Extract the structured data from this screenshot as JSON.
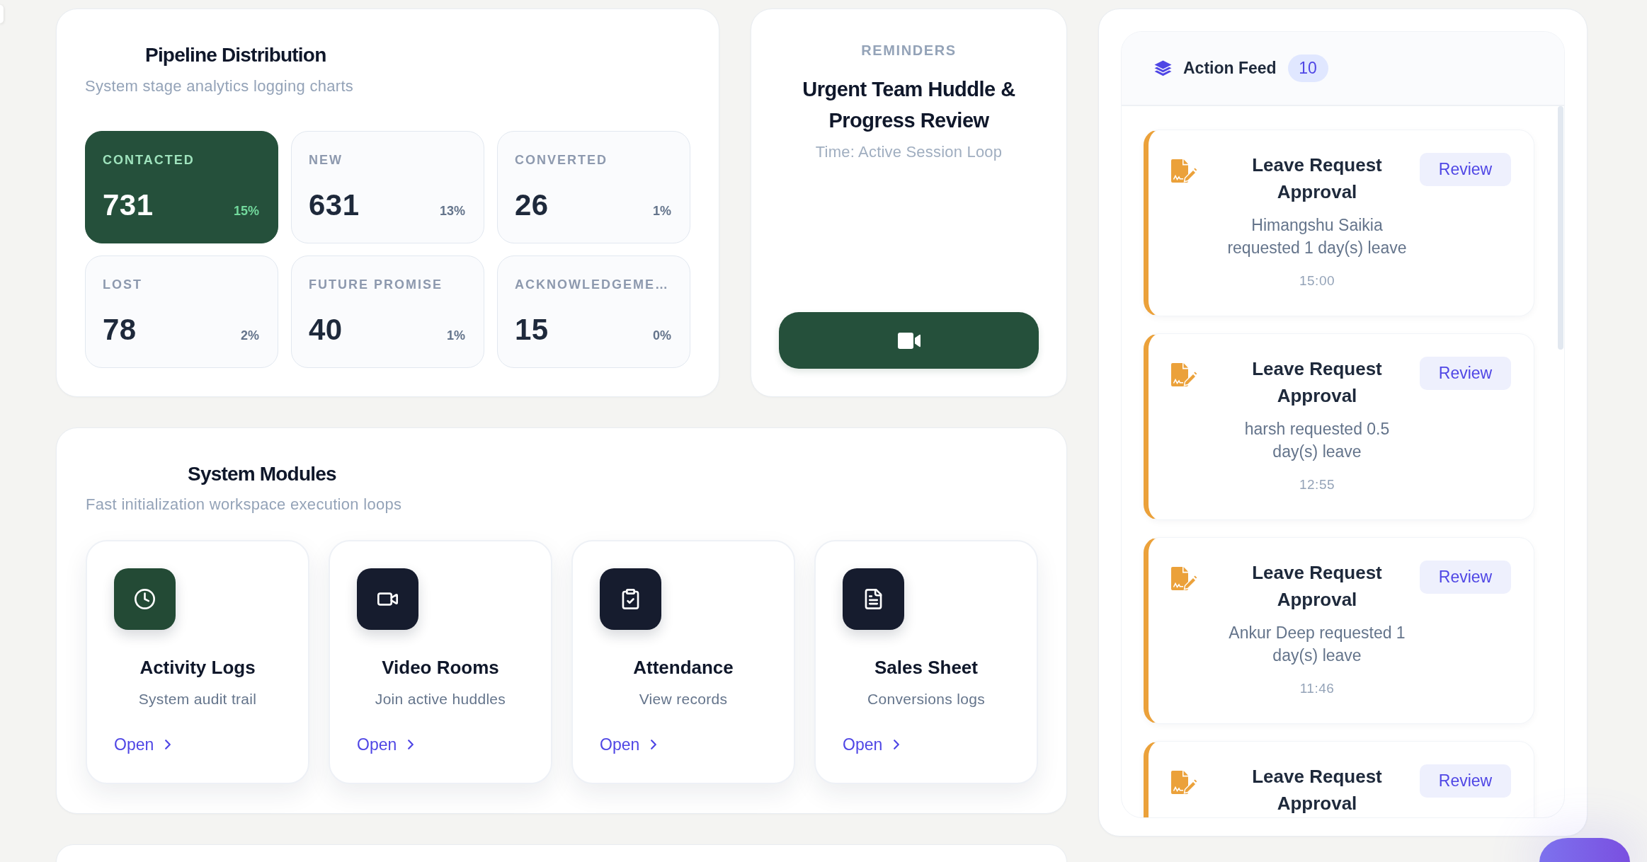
{
  "pipeline": {
    "title": "Pipeline Distribution",
    "subtitle": "System stage analytics logging charts",
    "stages": [
      {
        "label": "CONTACTED",
        "count": "731",
        "share": "15%",
        "selected": true
      },
      {
        "label": "NEW",
        "count": "631",
        "share": "13%",
        "selected": false
      },
      {
        "label": "CONVERTED",
        "count": "26",
        "share": "1%",
        "selected": false
      },
      {
        "label": "LOST",
        "count": "78",
        "share": "2%",
        "selected": false
      },
      {
        "label": "FUTURE PROMISE",
        "count": "40",
        "share": "1%",
        "selected": false
      },
      {
        "label": "ACKNOWLEDGEME…",
        "count": "15",
        "share": "0%",
        "selected": false
      }
    ]
  },
  "reminder": {
    "heading": "REMINDERS",
    "title": "Urgent Team Huddle & Progress Review",
    "time": "Time: Active Session Loop"
  },
  "modules": {
    "title": "System Modules",
    "subtitle": "Fast initialization workspace execution loops",
    "items": [
      {
        "kind": "clock",
        "color": "#234a35",
        "title": "Activity Logs",
        "description": "System audit trail",
        "link": "Open"
      },
      {
        "kind": "video",
        "color": "#161c2e",
        "title": "Video Rooms",
        "description": "Join active huddles",
        "link": "Open"
      },
      {
        "kind": "clipboard",
        "color": "#161c2e",
        "title": "Attendance",
        "description": "View records",
        "link": "Open"
      },
      {
        "kind": "document",
        "color": "#161c2e",
        "title": "Sales Sheet",
        "description": "Conversions logs",
        "link": "Open"
      }
    ]
  },
  "action_feed": {
    "title": "Action Feed",
    "count": "10",
    "items": [
      {
        "title": "Leave Request Approval",
        "description": "Himangshu Saikia requested 1 day(s) leave",
        "time": "15:00",
        "action": "Review"
      },
      {
        "title": "Leave Request Approval",
        "description": "harsh requested 0.5 day(s) leave",
        "time": "12:55",
        "action": "Review"
      },
      {
        "title": "Leave Request Approval",
        "description": "Ankur Deep requested 1 day(s) leave",
        "time": "11:46",
        "action": "Review"
      },
      {
        "title": "Leave Request Approval",
        "action": "Review"
      }
    ]
  }
}
